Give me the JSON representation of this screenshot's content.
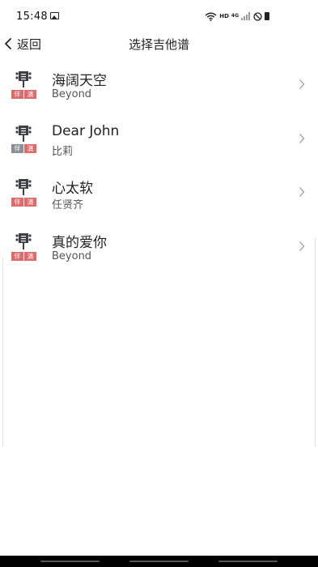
{
  "status_bar": {
    "time": "15:48",
    "hd": "HD",
    "network": "4G"
  },
  "nav": {
    "back_label": "返回",
    "title": "选择吉他谱"
  },
  "songs": [
    {
      "title": "海阔天空",
      "artist": "Beyond",
      "badges": [
        "伴",
        "演"
      ],
      "badge_colors": [
        "#e06a6a",
        "#e06a6a"
      ]
    },
    {
      "title": "Dear John",
      "artist": "比莉",
      "badges": [
        "伴",
        "演"
      ],
      "badge_colors": [
        "#8a8f96",
        "#e06a6a"
      ]
    },
    {
      "title": "心太软",
      "artist": "任贤齐",
      "badges": [
        "伴",
        "演"
      ],
      "badge_colors": [
        "#e06a6a",
        "#e06a6a"
      ]
    },
    {
      "title": "真的爱你",
      "artist": "Beyond",
      "badges": [
        "伴",
        "演"
      ],
      "badge_colors": [
        "#e06a6a",
        "#e06a6a"
      ]
    }
  ],
  "icons": {
    "song": "guitar-headstock-icon",
    "row_action": "chevron-right-icon",
    "back": "chevron-left-icon"
  }
}
